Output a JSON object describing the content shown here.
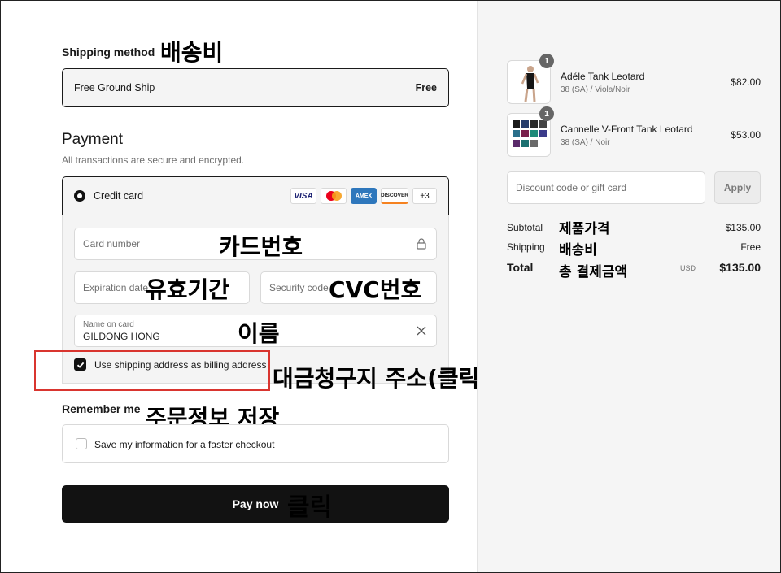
{
  "shipping": {
    "title": "Shipping method",
    "annotation": "배송비",
    "option": "Free Ground Ship",
    "price": "Free"
  },
  "payment": {
    "title": "Payment",
    "subtitle": "All transactions are secure and encrypted.",
    "method": "Credit card",
    "brands": [
      "VISA",
      "MC",
      "AMEX",
      "DISCOVER",
      "+3"
    ],
    "card_number_placeholder": "Card number",
    "expiration_placeholder": "Expiration date",
    "security_placeholder": "Security code",
    "name_label": "Name on card",
    "name_value": "GILDONG HONG",
    "billing_label": "Use shipping address as billing address",
    "billing_checked": true
  },
  "annotations": {
    "card_number": "카드번호",
    "expiration": "유효기간",
    "cvc": "CVC번호",
    "name": "이름",
    "billing": "대금청구지 주소(클릭o)",
    "remember": "주문정보 저장",
    "pay": "클릭",
    "subtotal": "제품가격",
    "shipping": "배송비",
    "total": "총 결제금액"
  },
  "remember": {
    "title": "Remember me",
    "label": "Save my information for a faster checkout",
    "checked": false
  },
  "pay_button": "Pay now",
  "cart": {
    "items": [
      {
        "qty": "1",
        "name": "Adéle Tank Leotard",
        "variant": "38 (SA) / Viola/Noir",
        "price": "$82.00"
      },
      {
        "qty": "1",
        "name": "Cannelle V-Front Tank Leotard",
        "variant": "38 (SA) / Noir",
        "price": "$53.00"
      }
    ],
    "discount_placeholder": "Discount code or gift card",
    "apply_label": "Apply",
    "subtotal_label": "Subtotal",
    "subtotal_value": "$135.00",
    "shipping_label": "Shipping",
    "shipping_value": "Free",
    "total_label": "Total",
    "currency": "USD",
    "total_value": "$135.00"
  }
}
